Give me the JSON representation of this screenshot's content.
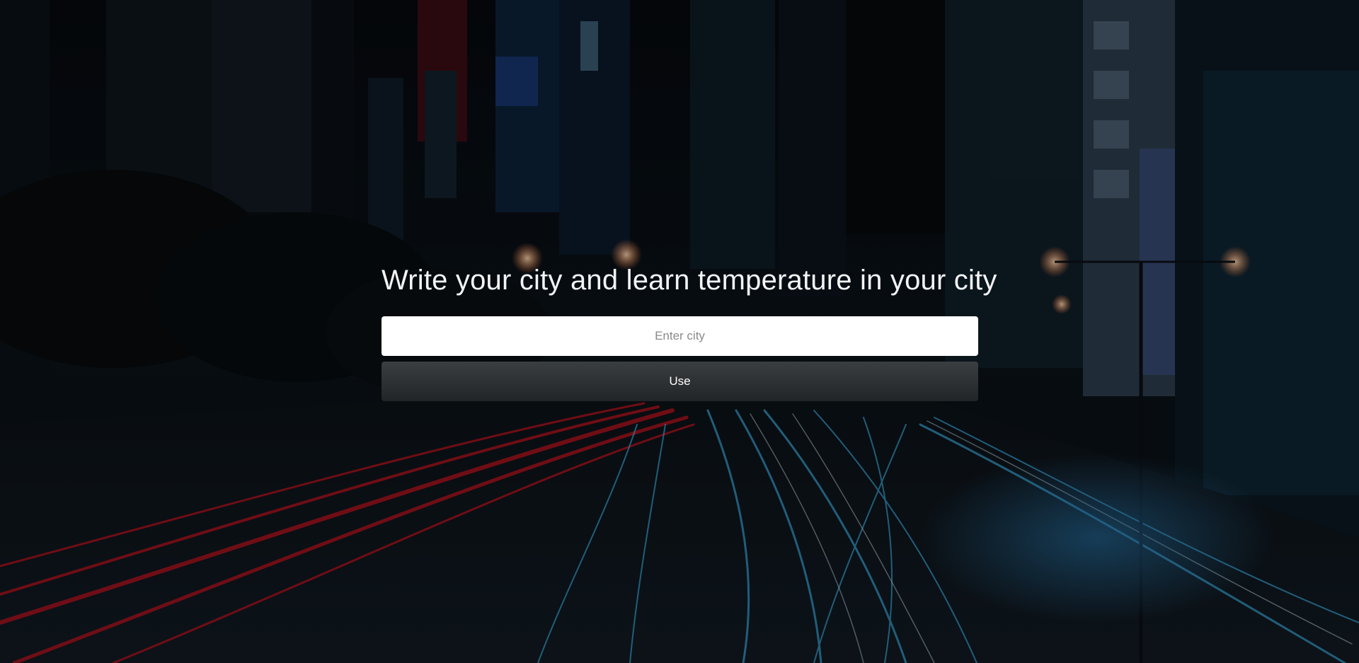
{
  "page": {
    "heading": "Write your city and learn temperature in your city"
  },
  "form": {
    "city_placeholder": "Enter city",
    "city_value": "",
    "submit_label": "Use"
  },
  "background": {
    "description_icon": "night-city-highway-photo",
    "colors": {
      "sky": "#05080d",
      "red_trails": "#b3121f",
      "blue_trails": "#3aa6d8",
      "buildings": "#0e1a24"
    }
  }
}
